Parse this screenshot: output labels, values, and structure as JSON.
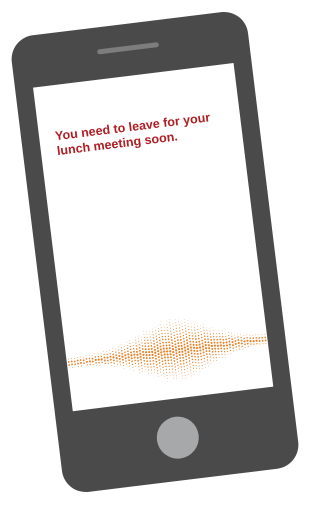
{
  "notification": {
    "message": "You need to leave for your lunch meeting soon."
  },
  "colors": {
    "phone_body": "#4a4a4a",
    "speaker": "#7d7d7d",
    "screen": "#ffffff",
    "message_text": "#b01e24",
    "waveform": "#e8832a",
    "home_button": "#a7a8a9"
  },
  "icons": {
    "waveform": "audio-waveform-icon",
    "home": "home-button-icon"
  }
}
